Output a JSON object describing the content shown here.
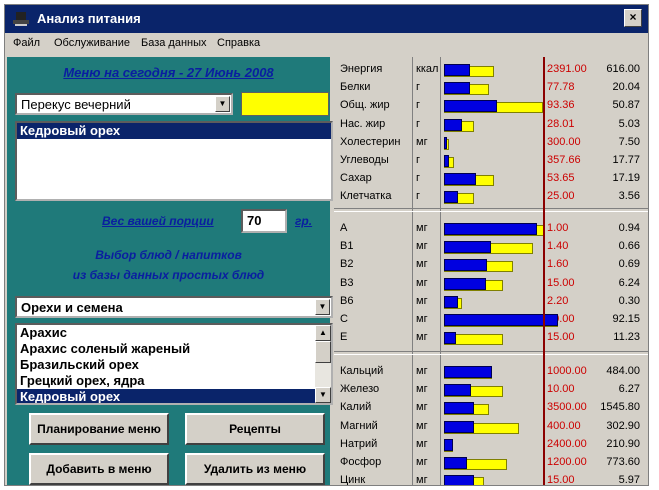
{
  "window": {
    "title": "Анализ питания",
    "close": "×"
  },
  "menubar": [
    "Файл",
    "Обслуживание",
    "База данных",
    "Справка"
  ],
  "left": {
    "menu_date": "Меню на сегодня - 27 Июнь 2008",
    "meal_select": "Перекус вечерний",
    "menu_items": [
      "Кедровый орех"
    ],
    "portion_label": "Вес вашей порции",
    "portion_value": "70",
    "portion_unit": "гр.",
    "choice_line1": "Выбор блюд / напитков",
    "choice_line2": "из базы данных простых блюд",
    "category_select": "Орехи и семена",
    "foods": [
      "Арахис",
      "Арахис соленый жареный",
      "Бразильский орех",
      "Грецкий орех, ядра",
      "Кедровый орех"
    ],
    "selected_food": "Кедровый орех",
    "buttons": {
      "plan": "Планирование меню",
      "recipes": "Рецепты",
      "add": "Добавить в меню",
      "delete": "Удалить из меню"
    }
  },
  "colors": {
    "blue_bar": "#0000e0",
    "yellow_bar": "#ffff00",
    "norm_text": "#cc0000",
    "panel": "#1f7a7a"
  },
  "nutrients": {
    "macros": [
      {
        "name": "Энергия",
        "unit": "ккал",
        "norm": "2391.00",
        "value": "616.00",
        "blue": 0.26,
        "yellow": 0.5
      },
      {
        "name": "Белки",
        "unit": "г",
        "norm": "77.78",
        "value": "20.04",
        "blue": 0.26,
        "yellow": 0.45
      },
      {
        "name": "Общ. жир",
        "unit": "г",
        "norm": "93.36",
        "value": "50.87",
        "blue": 0.54,
        "yellow": 1.0
      },
      {
        "name": "Нас. жир",
        "unit": "г",
        "norm": "28.01",
        "value": "5.03",
        "blue": 0.18,
        "yellow": 0.3
      },
      {
        "name": "Холестерин",
        "unit": "мг",
        "norm": "300.00",
        "value": "7.50",
        "blue": 0.03,
        "yellow": 0.05
      },
      {
        "name": "Углеводы",
        "unit": "г",
        "norm": "357.66",
        "value": "17.77",
        "blue": 0.05,
        "yellow": 0.1
      },
      {
        "name": "Сахар",
        "unit": "г",
        "norm": "53.65",
        "value": "17.19",
        "blue": 0.32,
        "yellow": 0.5
      },
      {
        "name": "Клетчатка",
        "unit": "г",
        "norm": "25.00",
        "value": "3.56",
        "blue": 0.14,
        "yellow": 0.3
      }
    ],
    "vitamins": [
      {
        "name": "A",
        "unit": "мг",
        "norm": "1.00",
        "value": "0.94",
        "blue": 0.94,
        "yellow": 1.02
      },
      {
        "name": "B1",
        "unit": "мг",
        "norm": "1.40",
        "value": "0.66",
        "blue": 0.47,
        "yellow": 0.9
      },
      {
        "name": "B2",
        "unit": "мг",
        "norm": "1.60",
        "value": "0.69",
        "blue": 0.43,
        "yellow": 0.7
      },
      {
        "name": "B3",
        "unit": "мг",
        "norm": "15.00",
        "value": "6.24",
        "blue": 0.42,
        "yellow": 0.6
      },
      {
        "name": "B6",
        "unit": "мг",
        "norm": "2.20",
        "value": "0.30",
        "blue": 0.14,
        "yellow": 0.18
      },
      {
        "name": "C",
        "unit": "мг",
        "norm": "80.00",
        "value": "92.15",
        "blue": 1.15,
        "yellow": 1.15
      },
      {
        "name": "E",
        "unit": "мг",
        "norm": "15.00",
        "value": "11.23",
        "blue": 0.12,
        "yellow": 0.6
      }
    ],
    "minerals": [
      {
        "name": "Кальций",
        "unit": "мг",
        "norm": "1000.00",
        "value": "484.00",
        "blue": 0.48,
        "yellow": 0.48
      },
      {
        "name": "Железо",
        "unit": "мг",
        "norm": "10.00",
        "value": "6.27",
        "blue": 0.27,
        "yellow": 0.6
      },
      {
        "name": "Калий",
        "unit": "мг",
        "norm": "3500.00",
        "value": "1545.80",
        "blue": 0.3,
        "yellow": 0.45
      },
      {
        "name": "Магний",
        "unit": "мг",
        "norm": "400.00",
        "value": "302.90",
        "blue": 0.3,
        "yellow": 0.76
      },
      {
        "name": "Натрий",
        "unit": "мг",
        "norm": "2400.00",
        "value": "210.90",
        "blue": 0.09,
        "yellow": 0.09
      },
      {
        "name": "Фосфор",
        "unit": "мг",
        "norm": "1200.00",
        "value": "773.60",
        "blue": 0.23,
        "yellow": 0.64
      },
      {
        "name": "Цинк",
        "unit": "мг",
        "norm": "15.00",
        "value": "5.97",
        "blue": 0.3,
        "yellow": 0.4
      }
    ]
  }
}
